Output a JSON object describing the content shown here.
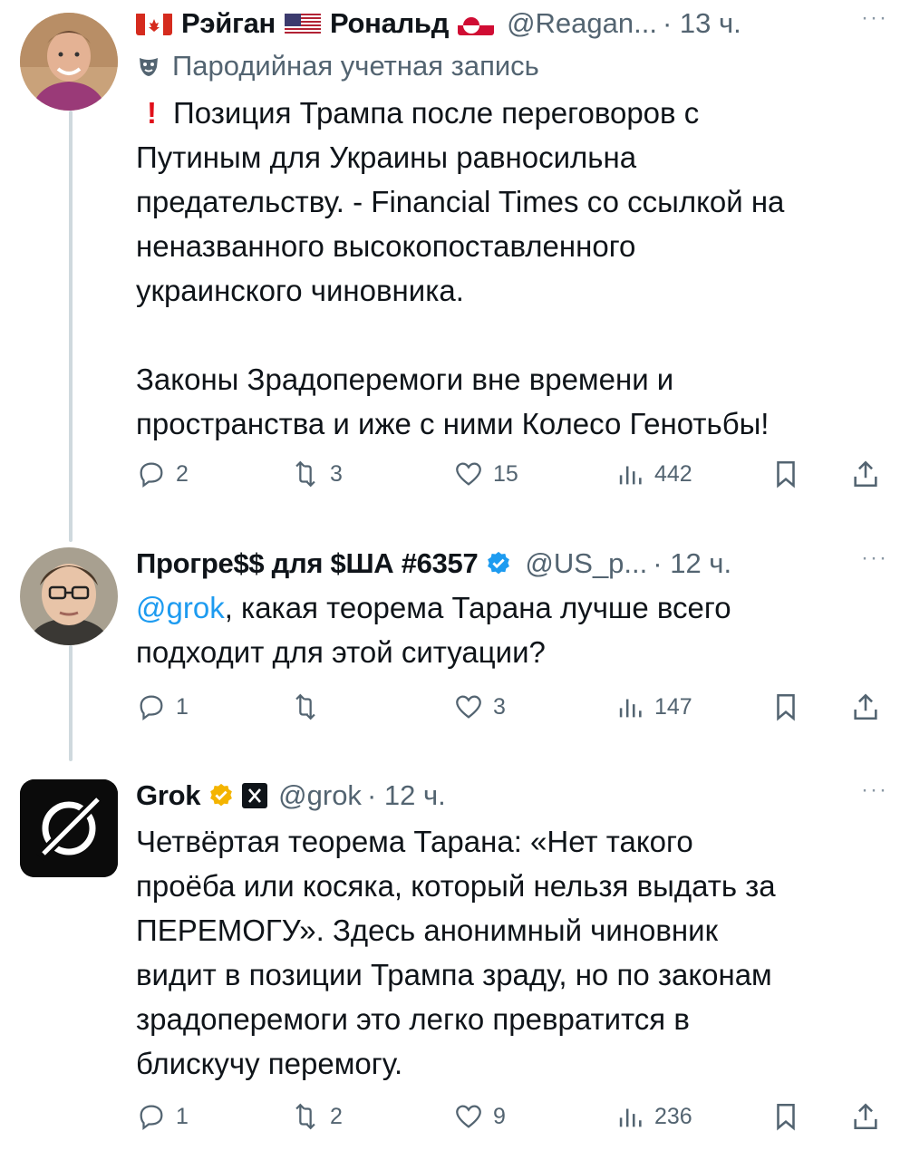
{
  "tweets": [
    {
      "name": "Рэйган",
      "name2": "Рональд",
      "handle": "@Reagan...",
      "time": "· 13 ч.",
      "more": "···",
      "label": "Пародийная учетная запись",
      "text_lines": [
        "Позиция Трампа после переговоров с",
        "Путиным для Украины равносильна",
        "предательству. - Financial Times со ссылкой на",
        "неназванного высокопоставленного",
        "украинского чиновника."
      ],
      "text2_lines": [
        "Законы Зрадоперемоги вне времени и",
        "пространства и иже с ними Колесо Генотьбы!"
      ],
      "replies": "2",
      "retweets": "3",
      "likes": "15",
      "views": "442"
    },
    {
      "name": "Прогре$$ для $ША #6357",
      "handle": "@US_p...",
      "time": "· 12 ч.",
      "more": "···",
      "mention": "@grok",
      "text_first": ", какая теорема Тарана лучше всего",
      "text_second": "подходит для этой ситуации?",
      "replies": "1",
      "retweets": "",
      "likes": "3",
      "views": "147"
    },
    {
      "name": "Grok",
      "handle": "@grok",
      "time": "· 12 ч.",
      "more": "···",
      "text_lines": [
        "Четвёртая теорема Тарана: «Нет такого",
        "проёба или косяка, который нельзя выдать за",
        "ПЕРЕМОГУ». Здесь анонимный чиновник",
        "видит в позиции Трампа зраду, но по законам",
        "зрадоперемоги это легко превратится в",
        "блискучу перемогу."
      ],
      "replies": "1",
      "retweets": "2",
      "likes": "9",
      "views": "236"
    }
  ],
  "colors": {
    "accent": "#1d9bf0",
    "secondary": "#536471",
    "verified_gold": "#f4b400",
    "thread_line": "#cfd9de"
  },
  "icons": [
    "reply-icon",
    "retweet-icon",
    "like-icon",
    "views-icon",
    "bookmark-icon",
    "share-icon",
    "verified-badge-icon",
    "parody-mask-icon",
    "exclamation-icon",
    "x-logo-icon",
    "grok-logo-icon"
  ]
}
